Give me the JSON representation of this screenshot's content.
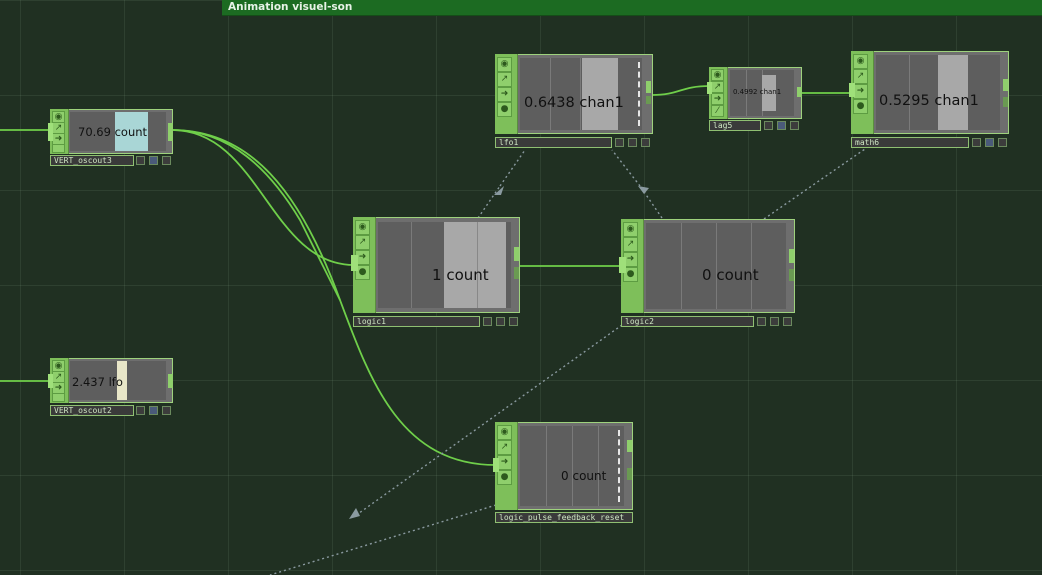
{
  "network": {
    "title": "Animation visuel-son"
  },
  "nodes": {
    "vert_oscout3": {
      "name": "VERT_oscout3",
      "value": "70.69",
      "channel": "count"
    },
    "vert_oscout2": {
      "name": "VERT_oscout2",
      "value": "2.437",
      "channel": "lfo"
    },
    "lfo1": {
      "name": "lfo1",
      "value": "0.6438",
      "channel": "chan1"
    },
    "lag5": {
      "name": "lag5",
      "value": "0.4992",
      "channel": "chan1"
    },
    "math6": {
      "name": "math6",
      "value": "0.5295",
      "channel": "chan1"
    },
    "logic1": {
      "name": "logic1",
      "value": "1",
      "channel": "count"
    },
    "logic2": {
      "name": "logic2",
      "value": "0",
      "channel": "count"
    },
    "logic_pulse_feedback_reset": {
      "name": "logic_pulse_feedback_reset",
      "value": "0",
      "channel": "count"
    }
  },
  "icons": [
    "viewer-flag-icon",
    "bypass-flag-icon",
    "display-flag-icon",
    "lock-flag-icon"
  ],
  "colors": {
    "background": "#203022",
    "banner": "#1c6b22",
    "wire": "#6fcf4a",
    "node_border": "#9ed27d",
    "export_dotted": "#8a9aa0"
  }
}
